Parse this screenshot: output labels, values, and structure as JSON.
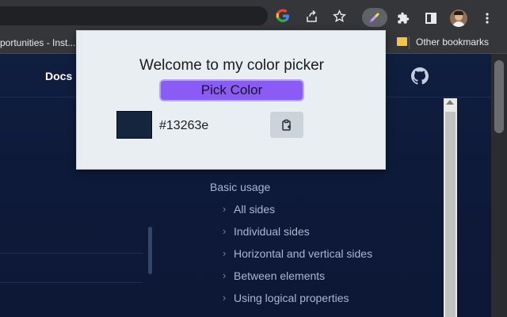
{
  "browser": {
    "toolbar_icons": [
      "google-icon",
      "share-icon",
      "star-icon",
      "color-picker-extension-icon",
      "extensions-puzzle-icon",
      "side-panel-icon",
      "profile-avatar",
      "kebab-menu-icon"
    ],
    "bookmarks": {
      "left_truncated": "portunities - Inst...",
      "other": "Other bookmarks"
    }
  },
  "page": {
    "nav_link": "Docs",
    "toc": {
      "heading": "Basic usage",
      "items": [
        "All sides",
        "Individual sides",
        "Horizontal and vertical sides",
        "Between elements",
        "Using logical properties"
      ]
    }
  },
  "popup": {
    "title": "Welcome to my color picker",
    "pick_button_label": "Pick Color",
    "color_value": "#13263e",
    "swatch_color": "#13263e",
    "accent_color": "#8a5cf5"
  }
}
